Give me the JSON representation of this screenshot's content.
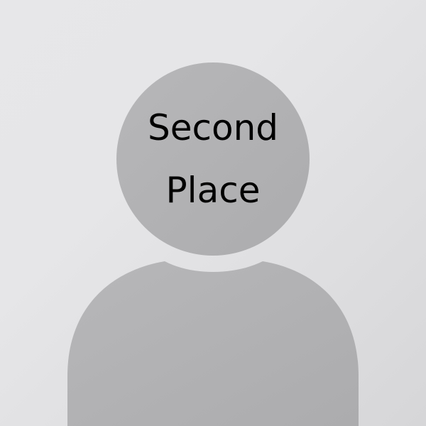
{
  "placeholder": {
    "label_line_1": "Second",
    "label_line_2": "Place",
    "icon": "person-silhouette-icon"
  },
  "colors": {
    "background": "#e6e6e8",
    "silhouette": "#b3b3b5",
    "text": "#000000"
  }
}
